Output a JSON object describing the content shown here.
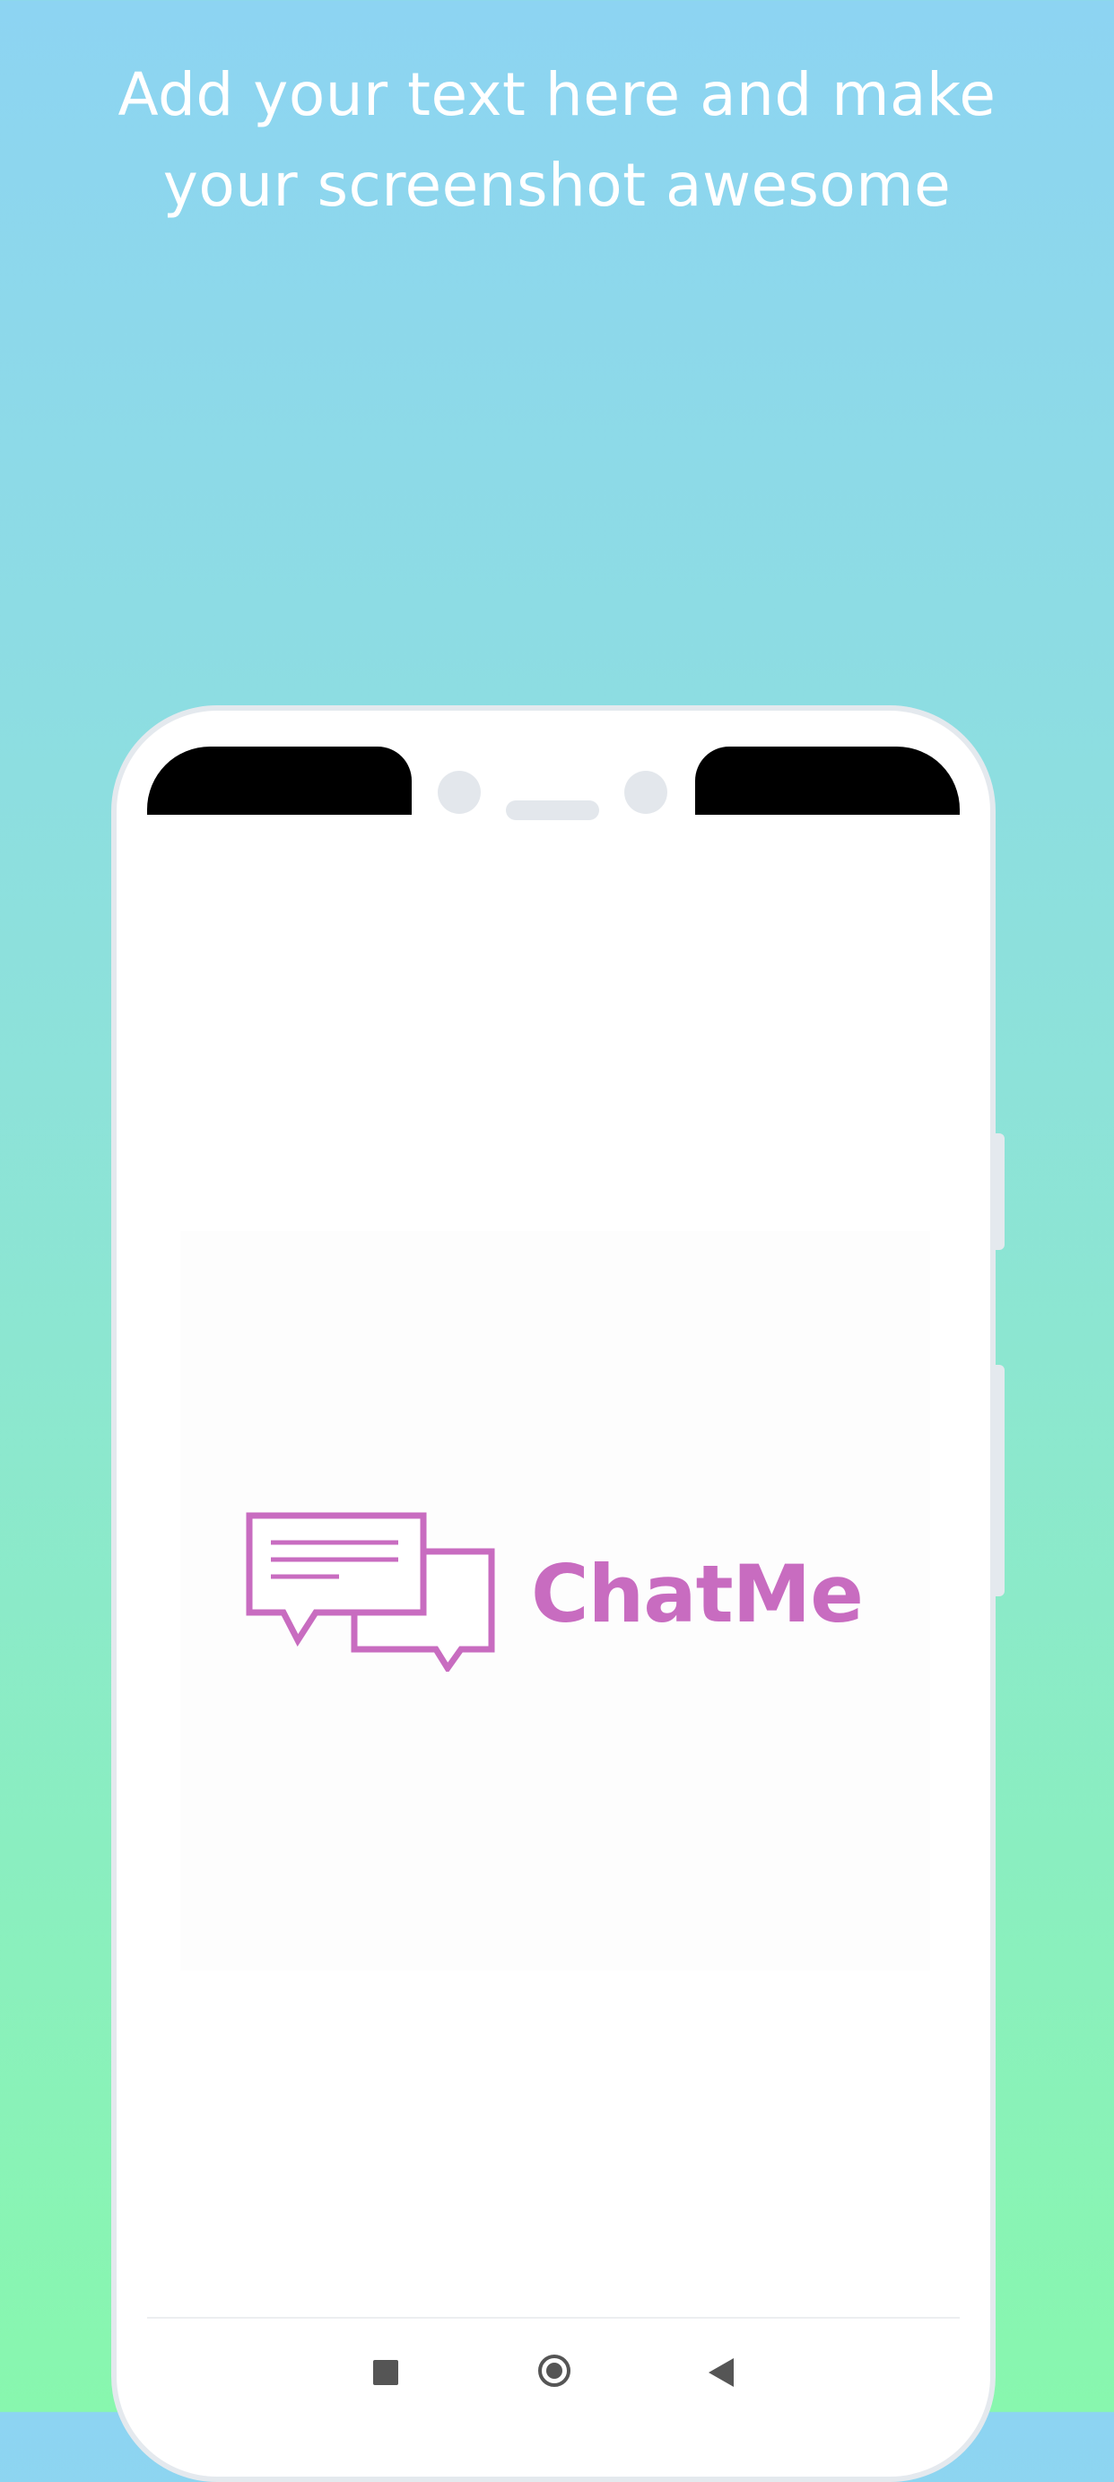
{
  "promo": {
    "headline_line1": "Add your text here and make",
    "headline_line2": "your screenshot awesome"
  },
  "app": {
    "name": "ChatMe",
    "brand_color": "#c86cc0"
  },
  "navbar": {
    "recents_icon": "square-icon",
    "home_icon": "circle-home-icon",
    "back_icon": "triangle-back-icon"
  },
  "colors": {
    "background_top": "#8dd4f2",
    "background_bottom": "#88f7ae",
    "phone_frame": "#e4e9ee"
  }
}
